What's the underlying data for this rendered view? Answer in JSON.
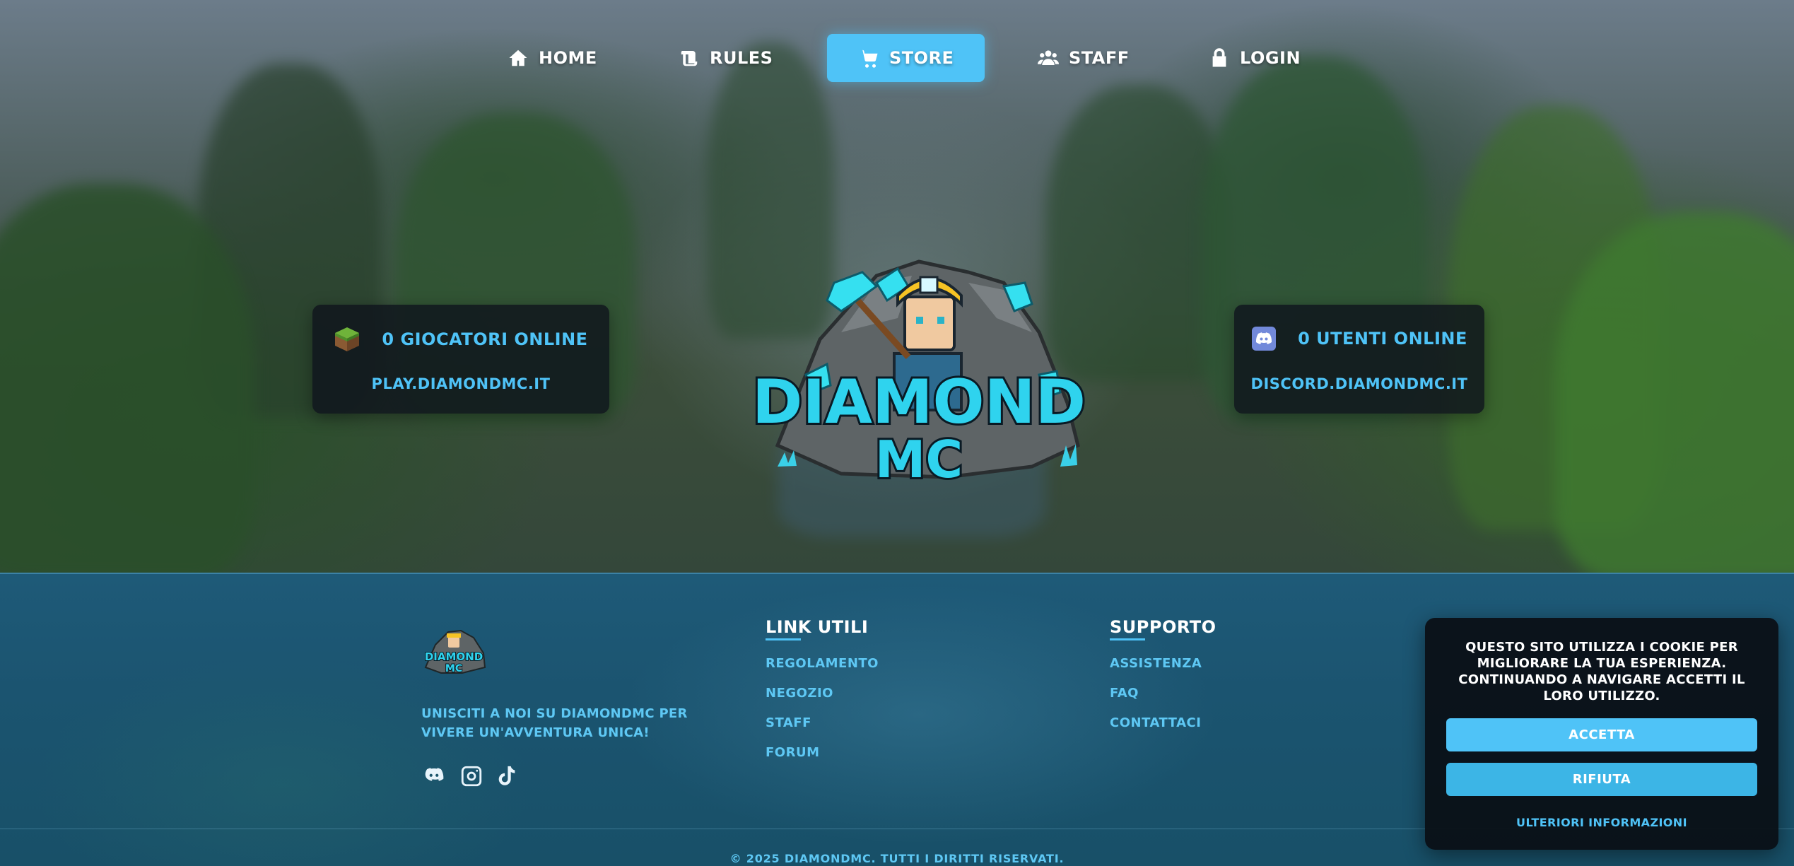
{
  "nav": {
    "items": [
      {
        "label": "HOME",
        "icon": "home-icon",
        "active": false
      },
      {
        "label": "RULES",
        "icon": "scroll-icon",
        "active": false
      },
      {
        "label": "STORE",
        "icon": "cart-icon",
        "active": true
      },
      {
        "label": "STAFF",
        "icon": "users-icon",
        "active": false
      },
      {
        "label": "LOGIN",
        "icon": "lock-icon",
        "active": false
      }
    ]
  },
  "server_card": {
    "icon": "grass-block-icon",
    "title": "0 GIOCATORI ONLINE",
    "address": "PLAY.DIAMONDMC.IT"
  },
  "discord_card": {
    "icon": "discord-icon",
    "title": "0 UTENTI ONLINE",
    "address": "DISCORD.DIAMONDMC.IT"
  },
  "logo": {
    "line1": "DIAMOND",
    "line2": "MC"
  },
  "footer": {
    "logo": {
      "line1": "DIAMOND",
      "line2": "MC"
    },
    "tagline": "UNISCITI A NOI SU DIAMONDMC PER VIVERE UN'AVVENTURA UNICA!",
    "social": [
      "discord-icon",
      "instagram-icon",
      "tiktok-icon"
    ],
    "links": {
      "title": "LINK UTILI",
      "items": [
        "REGOLAMENTO",
        "NEGOZIO",
        "STAFF",
        "FORUM"
      ]
    },
    "support": {
      "title": "SUPPORTO",
      "items": [
        "ASSISTENZA",
        "FAQ",
        "CONTATTACI"
      ]
    },
    "copyright": "© 2025 DIAMONDMC. TUTTI I DIRITTI RISERVATI."
  },
  "cookie": {
    "text": "QUESTO SITO UTILIZZA I COOKIE PER MIGLIORARE LA TUA ESPERIENZA. CONTINUANDO A NAVIGARE ACCETTI IL LORO UTILIZZO.",
    "accept": "ACCETTA",
    "reject": "RIFIUTA",
    "more": "ULTERIORI INFORMAZIONI"
  },
  "colors": {
    "accent": "#4fc3f7",
    "accept_button": "#4fc3f7",
    "reject_button": "#3cb5e6",
    "card_bg": "#0f141c",
    "footer_bg": "#1b5470"
  }
}
